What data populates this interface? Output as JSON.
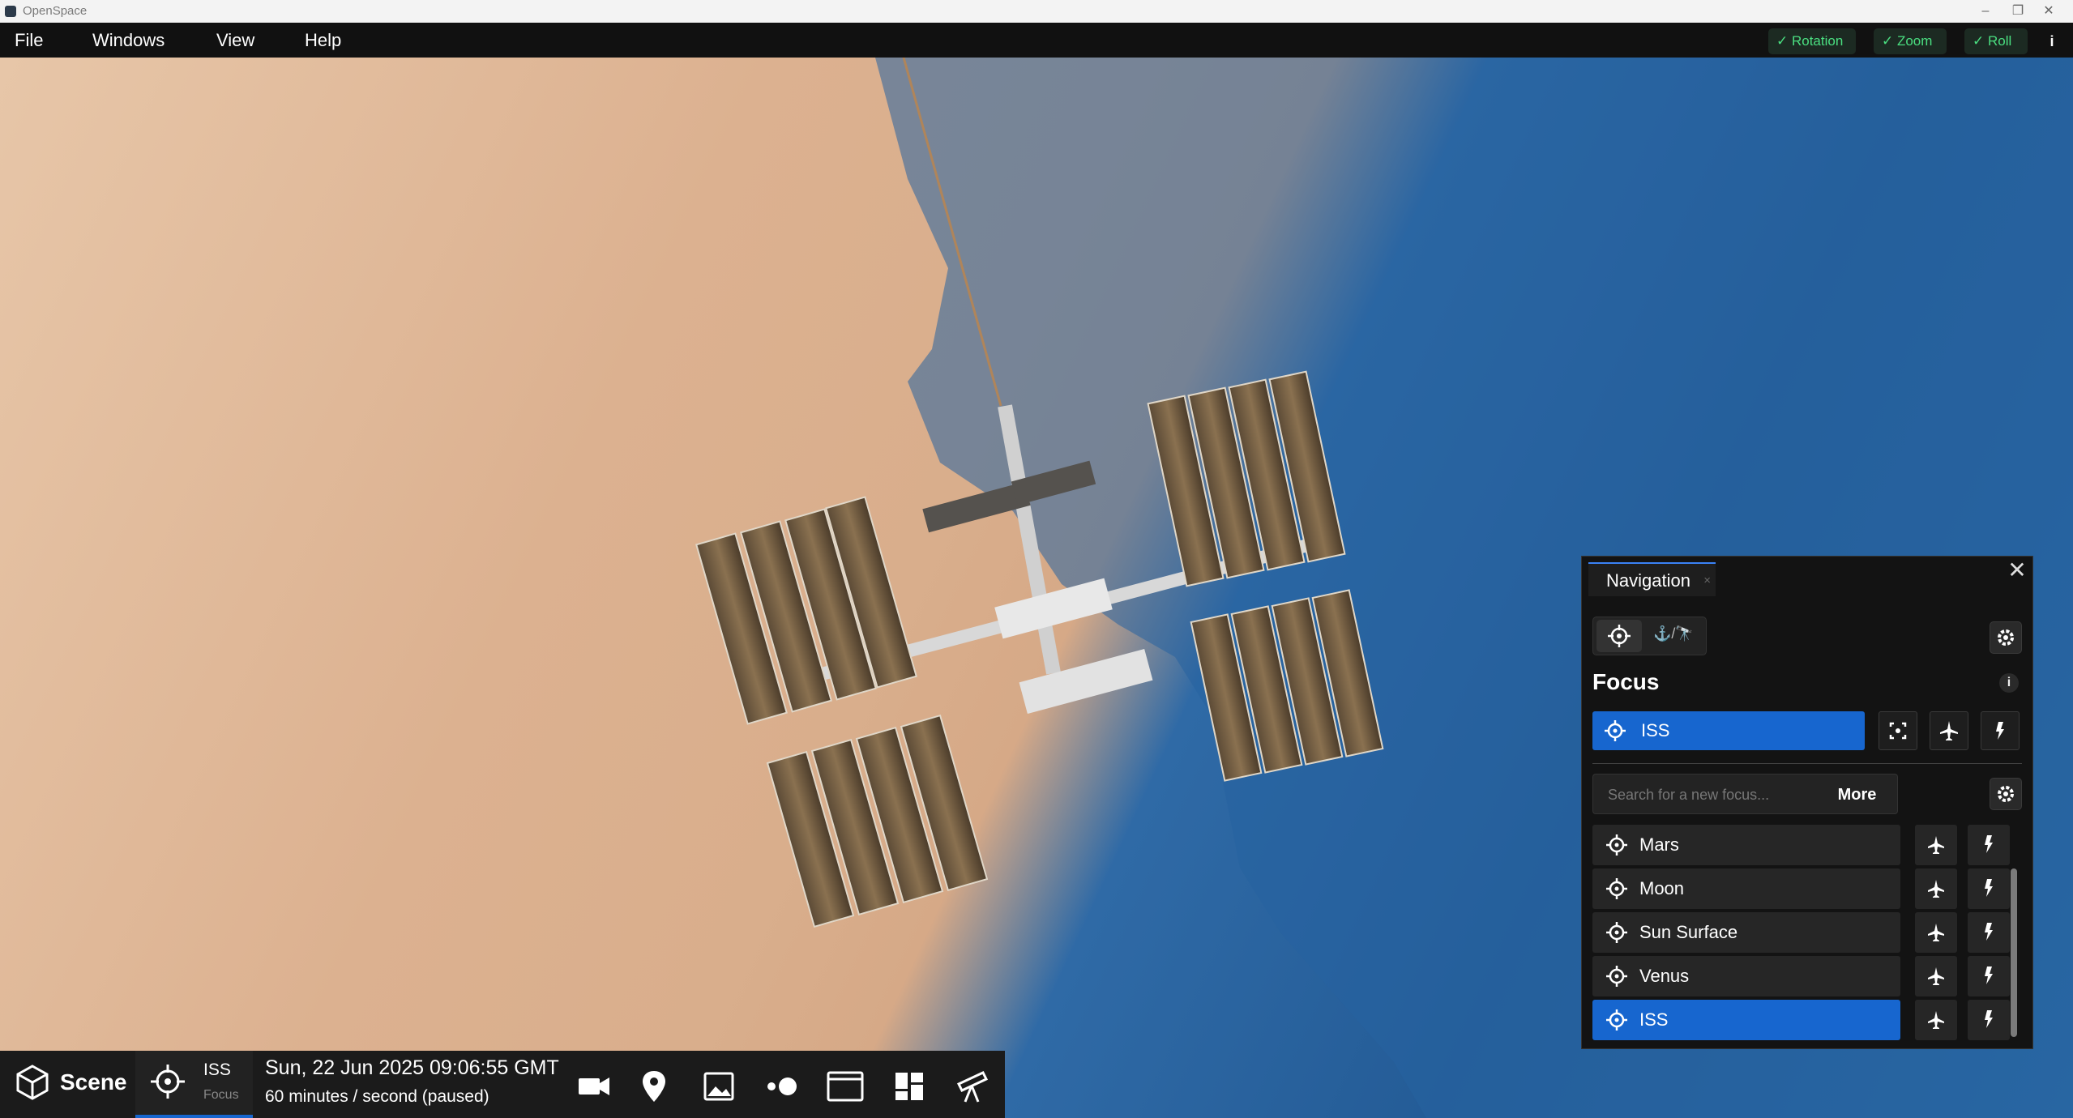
{
  "window": {
    "title": "OpenSpace",
    "minimize": "–",
    "restore": "❐",
    "close": "✕"
  },
  "menu": [
    {
      "label": "File"
    },
    {
      "label": "Windows"
    },
    {
      "label": "View"
    },
    {
      "label": "Help"
    }
  ],
  "camera_toggles": [
    {
      "label": "✓ Rotation",
      "checked": true
    },
    {
      "label": "✓ Zoom",
      "checked": true
    },
    {
      "label": "✓ Roll",
      "checked": true
    }
  ],
  "info_label": "i",
  "bottom_bar": {
    "scene_label": "Scene",
    "focus_name": "ISS",
    "focus_caption": "Focus",
    "date_time": "Sun, 22 Jun 2025 09:06:55 GMT",
    "time_rate": "60 minutes / second (paused)",
    "icons": [
      "camera-icon",
      "location-pin-icon",
      "image-icon",
      "exoplanets-icon",
      "browser-window-icon",
      "dashboard-icon",
      "telescope-icon"
    ]
  },
  "navigation": {
    "tab_title": "Navigation",
    "tab_close": "×",
    "panel_close": "✕",
    "mode_anchor_label": "⚓/🔭",
    "focus_heading": "Focus",
    "info": "i",
    "current_focus": "ISS",
    "search_placeholder": "Search for a new focus...",
    "more_label": "More",
    "list": [
      {
        "name": "Mars",
        "selected": false
      },
      {
        "name": "Moon",
        "selected": false
      },
      {
        "name": "Sun Surface",
        "selected": false
      },
      {
        "name": "Venus",
        "selected": false
      },
      {
        "name": "ISS",
        "selected": true
      }
    ]
  },
  "colors": {
    "accent": "#1766cf",
    "toggle_green": "#4ade80",
    "panel_bg": "#131313"
  }
}
